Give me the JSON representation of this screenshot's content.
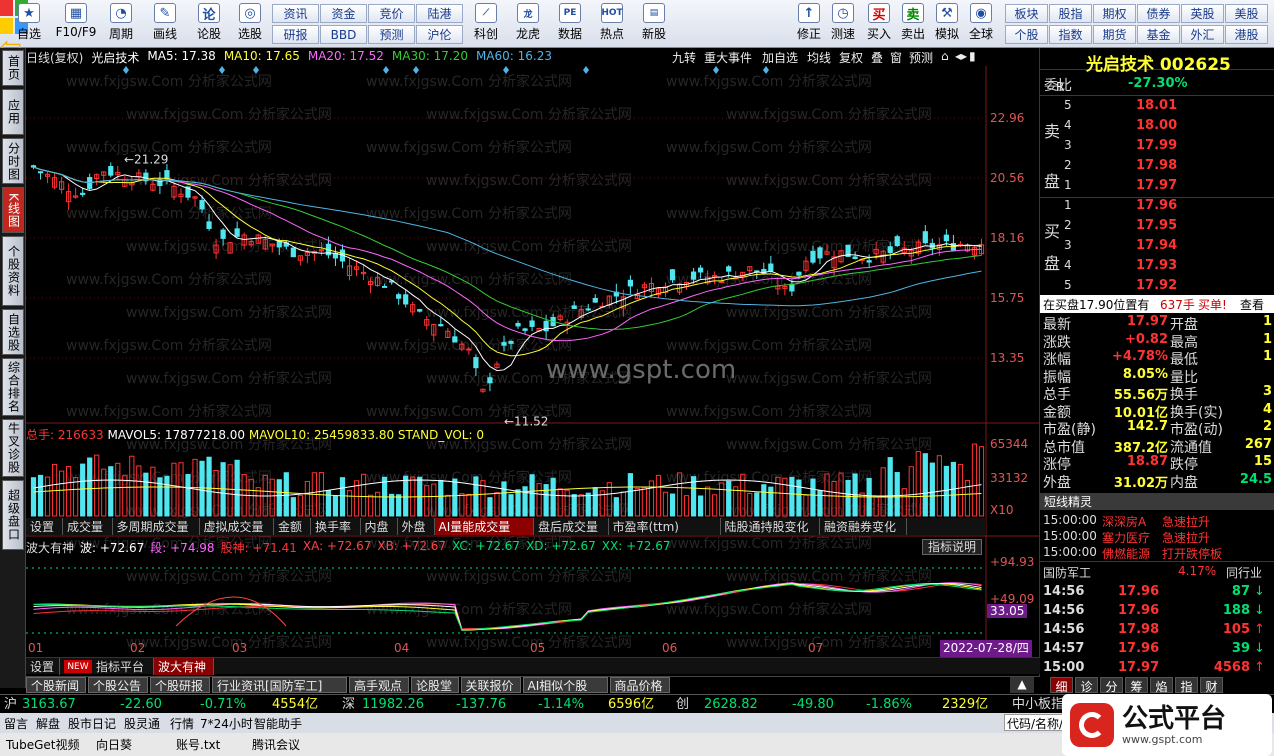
{
  "toolbar": {
    "left_buttons": [
      "自选",
      "F10/F9",
      "周期",
      "画线",
      "论股",
      "选股"
    ],
    "grid1_top": [
      "资讯",
      "资金",
      "竞价",
      "陆港"
    ],
    "grid1_bottom": [
      "研报",
      "BBD",
      "预测",
      "沪伦"
    ],
    "mid_buttons": [
      "科创",
      "龙虎",
      "数据",
      "热点",
      "新股"
    ],
    "right_buttons": [
      "修正",
      "测速",
      "买入",
      "卖出",
      "模拟",
      "全球"
    ],
    "grid2_top": [
      "板块",
      "股指",
      "期权",
      "债券",
      "英股",
      "美股"
    ],
    "grid2_bottom": [
      "个股",
      "指数",
      "期货",
      "基金",
      "外汇",
      "港股"
    ]
  },
  "sidebar": [
    "首页",
    "应用",
    "分时图",
    "K线图",
    "个股资料",
    "自选股",
    "综合排名",
    "牛叉诊股",
    "超级盘口"
  ],
  "chart_header": {
    "period": "日线(复权)",
    "name": "光启技术",
    "ma5": "MA5: 17.38",
    "ma10": "MA10: 17.65",
    "ma20": "MA20: 17.52",
    "ma30": "MA30: 17.20",
    "ma60": "MA60: 16.23"
  },
  "chart_tools": [
    "九转",
    "重大事件",
    "加自选",
    "均线",
    "复权",
    "叠",
    "窗",
    "预测"
  ],
  "watermark": "www.fxjgsw.Com 分析家公式网",
  "site_watermark": "www.gspt.com",
  "price_axis": [
    "22.96",
    "20.56",
    "18.16",
    "15.75",
    "13.35"
  ],
  "annotations": {
    "high": "21.29",
    "low": "11.52"
  },
  "volume_header": {
    "total": "总手: 216633",
    "mavol5": "MAVOL5: 17877218.00",
    "mavol10": "MAVOL10: 25459833.80",
    "standvol": "STAND_VOL: 0"
  },
  "volume_axis": [
    "65344",
    "33132",
    "X10"
  ],
  "indicator_tabs": [
    "设置",
    "成交量",
    "多周期成交量",
    "虚拟成交量",
    "金额",
    "换手率",
    "内盘",
    "外盘",
    "AI量能成交量",
    "盘后成交量",
    "市盈率(ttm)",
    "陆股通持股变化",
    "融资融券变化"
  ],
  "wave_header": {
    "name": "波大有神",
    "wave": "波: +72.67",
    "duan": "段: +74.98",
    "gushen": "股神: +71.41",
    "xa": "XA: +72.67",
    "xb": "XB: +72.67",
    "xc": "XC: +72.67",
    "xd": "XD: +72.67",
    "xx": "XX: +72.67"
  },
  "wave_help": "指标说明",
  "wave_axis": [
    "94.93",
    "49.09",
    "33.05"
  ],
  "date_label": "2022-07-28/四",
  "months": [
    "01",
    "02",
    "03",
    "04",
    "05",
    "06",
    "07"
  ],
  "formula_tabs": {
    "settings": "设置",
    "new_badge": "NEW",
    "platform": "指标平台",
    "current": "波大有神"
  },
  "info_tabs": [
    "个股新闻",
    "个股公告",
    "个股研报",
    "行业资讯[国防军工]",
    "高手观点",
    "论股堂",
    "关联报价",
    "AI相似个股",
    "商品价格"
  ],
  "quote": {
    "stock_title": "光启技术 002625",
    "r_label": "R",
    "webi": "委比",
    "webi_val": "-27.30%",
    "sell": [
      {
        "n": "5",
        "p": "18.01"
      },
      {
        "n": "4",
        "p": "18.00"
      },
      {
        "n": "3",
        "p": "17.99"
      },
      {
        "n": "2",
        "p": "17.98"
      },
      {
        "n": "1",
        "p": "17.97"
      }
    ],
    "buy": [
      {
        "n": "1",
        "p": "17.96"
      },
      {
        "n": "2",
        "p": "17.95"
      },
      {
        "n": "3",
        "p": "17.94"
      },
      {
        "n": "4",
        "p": "17.93"
      },
      {
        "n": "5",
        "p": "17.92"
      }
    ],
    "sell_label": [
      "卖",
      "盘"
    ],
    "buy_label": [
      "买",
      "盘"
    ],
    "notice": "在买盘17.90位置有",
    "notice_vol": "637手",
    "notice_act": "买单!",
    "notice_btn": "查看",
    "rows": [
      {
        "k1": "最新",
        "v1": "17.97",
        "k2": "开盘",
        "v2": "1"
      },
      {
        "k1": "涨跌",
        "v1": "+0.82",
        "k2": "最高",
        "v2": "1"
      },
      {
        "k1": "涨幅",
        "v1": "+4.78%",
        "k2": "最低",
        "v2": "1"
      },
      {
        "k1": "振幅",
        "v1": "8.05%",
        "k2": "量比",
        "v2": ""
      },
      {
        "k1": "总手",
        "v1": "55.56万",
        "k2": "换手",
        "v2": "3"
      },
      {
        "k1": "金额",
        "v1": "10.01亿",
        "k2": "换手(实)",
        "v2": "4"
      },
      {
        "k1": "市盈(静)",
        "v1": "142.7",
        "k2": "市盈(动)",
        "v2": "2"
      },
      {
        "k1": "总市值",
        "v1": "387.2亿",
        "k2": "流通值",
        "v2": "267"
      },
      {
        "k1": "涨停",
        "v1": "18.87",
        "k2": "跌停",
        "v2": "15"
      },
      {
        "k1": "外盘",
        "v1": "31.02万",
        "k2": "内盘",
        "v2": "24.5"
      }
    ],
    "spirit_title": "短线精灵",
    "spirit": [
      {
        "t": "15:00:00",
        "n": "深深房A",
        "e": "急速拉升"
      },
      {
        "t": "15:00:00",
        "n": "塞力医疗",
        "e": "急速拉升"
      },
      {
        "t": "15:00:00",
        "n": "佛燃能源",
        "e": "打开跌停板"
      }
    ],
    "industry": "国防军工",
    "industry_pct": "4.17%",
    "industry_btn": "同行业",
    "ticks": [
      {
        "t": "14:56",
        "p": "17.96",
        "v": "87",
        "d": "down"
      },
      {
        "t": "14:56",
        "p": "17.96",
        "v": "188",
        "d": "down"
      },
      {
        "t": "14:56",
        "p": "17.98",
        "v": "105",
        "d": "up"
      },
      {
        "t": "14:57",
        "p": "17.96",
        "v": "39",
        "d": "down"
      },
      {
        "t": "15:00",
        "p": "17.97",
        "v": "4568",
        "d": "up"
      }
    ],
    "bottom_tabs": [
      "细",
      "诊",
      "分",
      "筹",
      "焰",
      "指",
      "财"
    ]
  },
  "status": {
    "sh": "沪",
    "sh_idx": "3163.67",
    "sh_chg": "-22.60",
    "sh_pct": "-0.71%",
    "sh_amt": "4554亿",
    "sz": "深",
    "sz_idx": "11982.26",
    "sz_chg": "-137.76",
    "sz_pct": "-1.14%",
    "sz_amt": "6596亿",
    "cy": "创",
    "cy_idx": "2628.82",
    "cy_chg": "-49.80",
    "cy_pct": "-1.86%",
    "cy_amt": "2329亿",
    "zx": "中小板指"
  },
  "bottom_bar": [
    "留言",
    "解盘",
    "股市日记",
    "股灵通",
    "行情",
    "7*24小时",
    "智能助手"
  ],
  "search_placeholder": "代码/名称/",
  "logo_text": "公式平台",
  "logo_url": "www.gspt.com",
  "taskbar": [
    "TubeGet视频",
    "向日葵",
    "账号.txt",
    "腾讯会议"
  ],
  "colors": {
    "up": "#ff3333",
    "down": "#50e6f0",
    "ma5": "#ffffff",
    "ma10": "#ffff33",
    "ma20": "#ff66ff",
    "ma30": "#33cc33",
    "ma60": "#4fb4e6"
  }
}
